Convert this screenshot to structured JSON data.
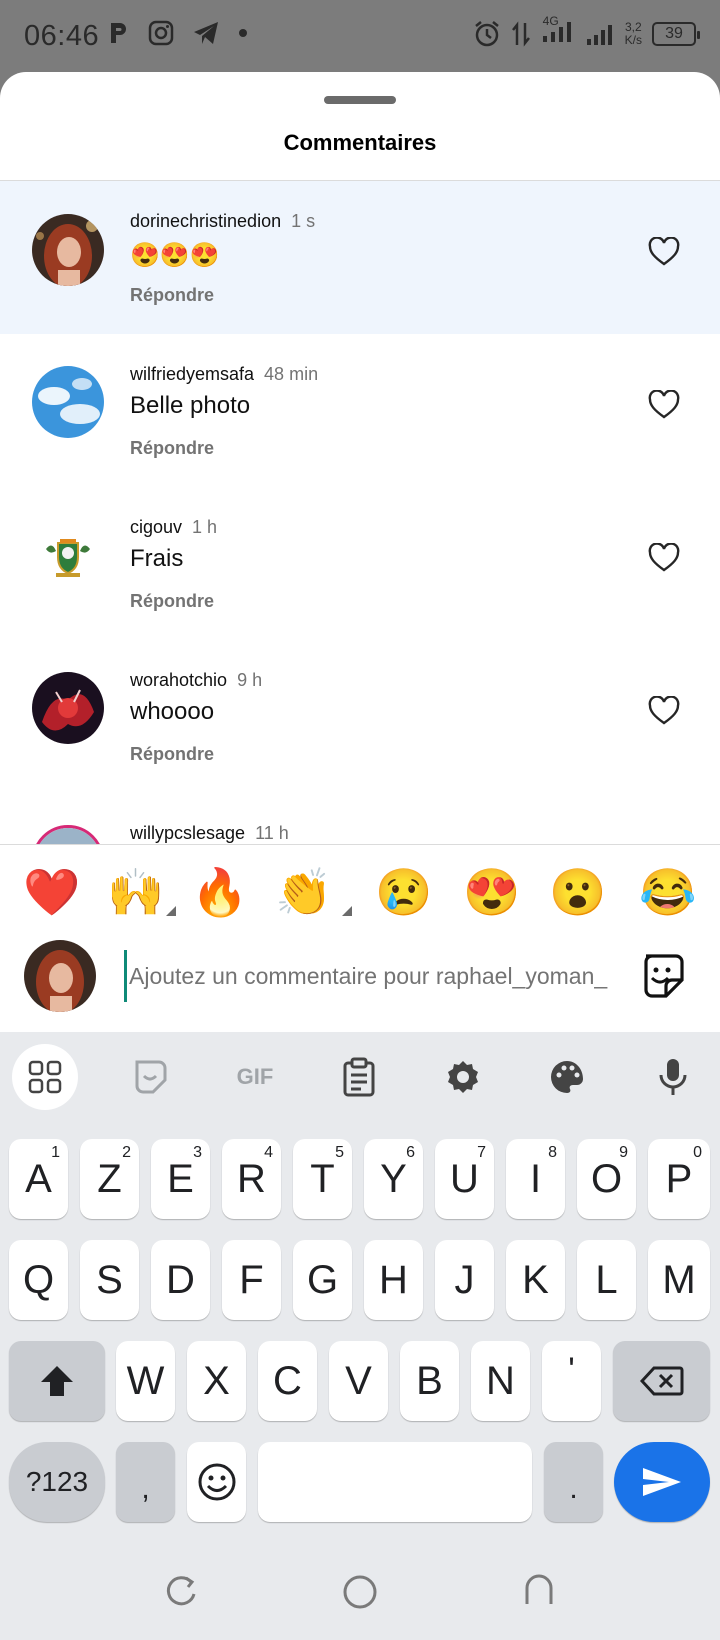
{
  "status_bar": {
    "time": "06:46",
    "network": "4G",
    "speed_value": "3,2",
    "speed_unit": "K/s",
    "battery": "39"
  },
  "sheet": {
    "title": "Commentaires"
  },
  "comments": [
    {
      "username": "dorinechristinedion",
      "time": "1 s",
      "text": "😍😍😍",
      "reply": "Répondre",
      "highlighted": true
    },
    {
      "username": "wilfriedyemsafa",
      "time": "48 min",
      "text": "Belle photo",
      "reply": "Répondre"
    },
    {
      "username": "cigouv",
      "time": "1 h",
      "text": "Frais",
      "reply": "Répondre"
    },
    {
      "username": "worahotchio",
      "time": "9 h",
      "text": "whoooo",
      "reply": "Répondre"
    },
    {
      "username": "willypcslesage",
      "time": "11 h"
    }
  ],
  "quick_reactions": [
    "❤️",
    "🙌",
    "🔥",
    "👏",
    "😢",
    "😍",
    "😮",
    "😂"
  ],
  "composer": {
    "placeholder": "Ajoutez un commentaire pour raphael_yoman_"
  },
  "keyboard": {
    "toolbar": [
      "apps-grid",
      "sticker",
      "GIF",
      "clipboard",
      "settings",
      "theme",
      "microphone"
    ],
    "gif_label": "GIF",
    "row1": [
      {
        "k": "A",
        "h": "1"
      },
      {
        "k": "Z",
        "h": "2"
      },
      {
        "k": "E",
        "h": "3"
      },
      {
        "k": "R",
        "h": "4"
      },
      {
        "k": "T",
        "h": "5"
      },
      {
        "k": "Y",
        "h": "6"
      },
      {
        "k": "U",
        "h": "7"
      },
      {
        "k": "I",
        "h": "8"
      },
      {
        "k": "O",
        "h": "9"
      },
      {
        "k": "P",
        "h": "0"
      }
    ],
    "row2": [
      "Q",
      "S",
      "D",
      "F",
      "G",
      "H",
      "J",
      "K",
      "L",
      "M"
    ],
    "row3": [
      "W",
      "X",
      "C",
      "V",
      "B",
      "N",
      "'"
    ],
    "symbols_label": "?123",
    "comma": ",",
    "period": "."
  }
}
